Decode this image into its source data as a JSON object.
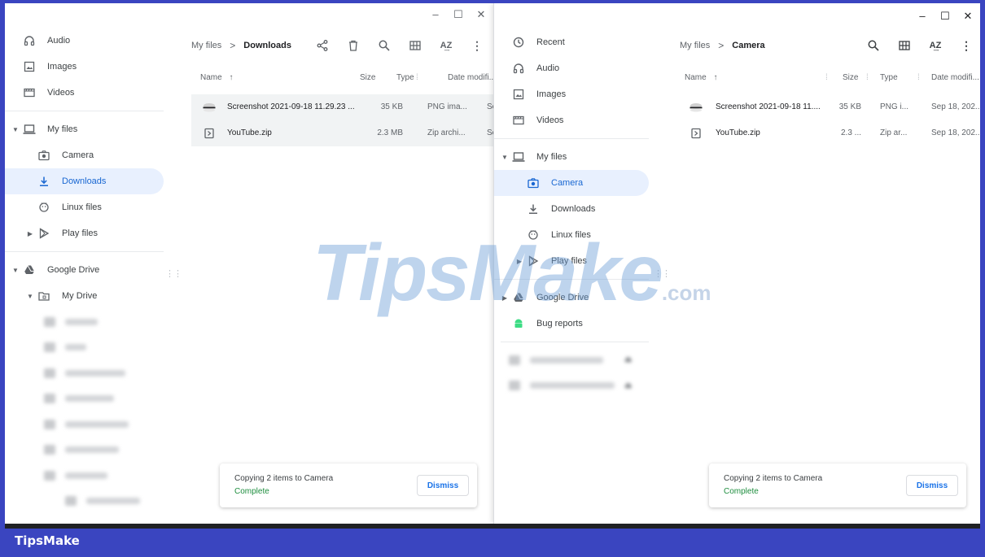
{
  "brand": "TipsMake",
  "watermark": {
    "main": "TipsMake",
    "suffix": ".com"
  },
  "left": {
    "breadcrumb": {
      "parent": "My files",
      "current": "Downloads"
    },
    "sidebar": [
      {
        "label": "Audio",
        "icon": "headphones-icon",
        "level": 0
      },
      {
        "label": "Images",
        "icon": "image-icon",
        "level": 0
      },
      {
        "label": "Videos",
        "icon": "video-icon",
        "level": 0
      },
      {
        "label": "My files",
        "icon": "laptop-icon",
        "level": 0,
        "expanded": true
      },
      {
        "label": "Camera",
        "icon": "camera-icon",
        "level": 1
      },
      {
        "label": "Downloads",
        "icon": "download-icon",
        "level": 1,
        "active": true
      },
      {
        "label": "Linux files",
        "icon": "linux-icon",
        "level": 1
      },
      {
        "label": "Play files",
        "icon": "play-icon",
        "level": 1,
        "collapsed": true
      },
      {
        "label": "Google Drive",
        "icon": "drive-icon",
        "level": 0,
        "expanded": true
      },
      {
        "label": "My Drive",
        "icon": "folder-icon",
        "level": 1,
        "expanded": true
      }
    ],
    "columns": {
      "name": "Name",
      "size": "Size",
      "type": "Type",
      "date": "Date modifi..."
    },
    "files": [
      {
        "name": "Screenshot 2021-09-18 11.29.23 ...",
        "size": "35 KB",
        "type": "PNG ima...",
        "date": "Se",
        "icon": "image-file-icon"
      },
      {
        "name": "YouTube.zip",
        "size": "2.3 MB",
        "type": "Zip archi...",
        "date": "Se",
        "icon": "zip-file-icon"
      }
    ],
    "toast": {
      "title": "Copying 2 items to Camera",
      "status": "Complete",
      "button": "Dismiss"
    }
  },
  "right": {
    "breadcrumb": {
      "parent": "My files",
      "current": "Camera"
    },
    "sidebar": [
      {
        "label": "Recent",
        "icon": "clock-icon",
        "level": 0
      },
      {
        "label": "Audio",
        "icon": "headphones-icon",
        "level": 0
      },
      {
        "label": "Images",
        "icon": "image-icon",
        "level": 0
      },
      {
        "label": "Videos",
        "icon": "video-icon",
        "level": 0
      },
      {
        "label": "My files",
        "icon": "laptop-icon",
        "level": 0,
        "expanded": true
      },
      {
        "label": "Camera",
        "icon": "camera-icon",
        "level": 1,
        "active": true
      },
      {
        "label": "Downloads",
        "icon": "download-icon",
        "level": 1
      },
      {
        "label": "Linux files",
        "icon": "linux-icon",
        "level": 1
      },
      {
        "label": "Play files",
        "icon": "play-icon",
        "level": 1,
        "collapsed": true
      },
      {
        "label": "Google Drive",
        "icon": "drive-icon",
        "level": 0,
        "collapsed": true
      },
      {
        "label": "Bug reports",
        "icon": "android-icon",
        "level": 0
      }
    ],
    "columns": {
      "name": "Name",
      "size": "Size",
      "type": "Type",
      "date": "Date modifi..."
    },
    "files": [
      {
        "name": "Screenshot 2021-09-18 11....",
        "size": "35 KB",
        "type": "PNG i...",
        "date": "Sep 18, 202...",
        "icon": "image-file-icon"
      },
      {
        "name": "YouTube.zip",
        "size": "2.3 ...",
        "type": "Zip ar...",
        "date": "Sep 18, 202...",
        "icon": "zip-file-icon"
      }
    ],
    "toast": {
      "title": "Copying 2 items to Camera",
      "status": "Complete",
      "button": "Dismiss"
    }
  },
  "colors": {
    "accent": "#1a73e8",
    "active_bg": "#e8f0fe",
    "complete": "#1e8e3e",
    "frame": "#3a45c0"
  }
}
